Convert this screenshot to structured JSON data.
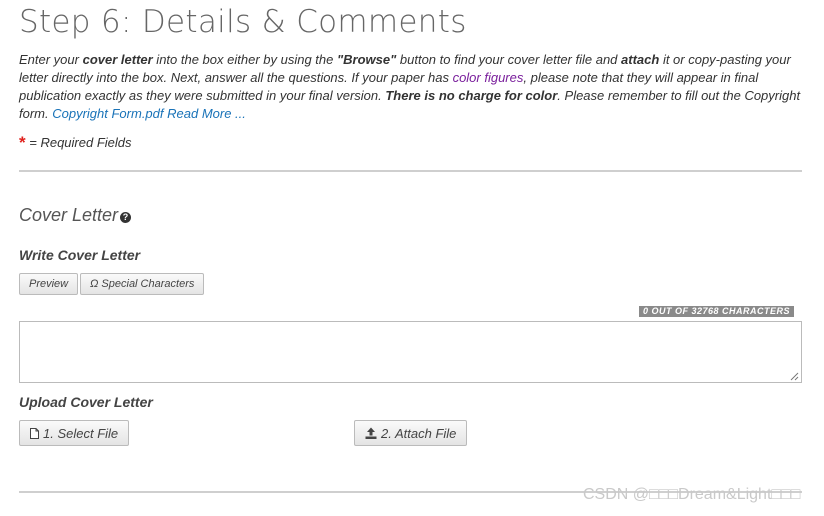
{
  "page_title": "Step 6: Details & Comments",
  "intro": {
    "p1": "Enter your ",
    "cover_letter": "cover letter",
    "p2": " into the box either by using the ",
    "browse": "\"Browse\"",
    "p3": " button to find your cover letter file and ",
    "attach": "attach",
    "p4": " it or copy-pasting your letter directly into the box. Next, answer all the questions. If your paper has ",
    "color_figures": "color figures",
    "p5": ", please note that they will appear in final publication exactly as they were submitted in your final version. ",
    "no_charge": "There is no charge for color",
    "p6": ". Please remember to fill out the Copyright form. ",
    "copyright_link": "Copyright Form.pdf",
    "read_more": "Read More ..."
  },
  "required": {
    "star": "*",
    "text": "= Required Fields"
  },
  "cover_letter_section": {
    "title": "Cover Letter",
    "help_icon": "question-circle-icon",
    "write_heading": "Write Cover Letter",
    "preview_label": "Preview",
    "special_chars_label": "Ω Special Characters",
    "counter": "0 OUT OF 32768 CHARACTERS",
    "textarea_value": "",
    "upload_heading": "Upload Cover Letter",
    "select_file_label": "1. Select File",
    "attach_file_label": "2. Attach File",
    "select_icon": "file-icon",
    "attach_icon": "upload-icon"
  },
  "watermark": "CSDN @□□□Dream&Light□□□",
  "colors": {
    "link": "#1a73b8",
    "purple_link": "#7a1f9c",
    "required_star": "#e0201b",
    "divider": "#cfcfcf"
  }
}
